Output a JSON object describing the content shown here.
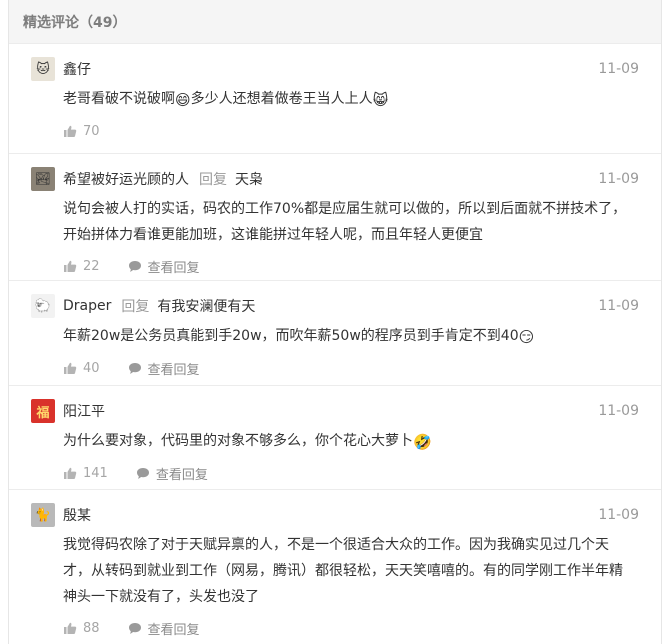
{
  "header": {
    "title": "精选评论（49）"
  },
  "comments": [
    {
      "user": "鑫仔",
      "reply_word": "",
      "reply_to": "",
      "date": "11-09",
      "text_a": "老哥看破不说破啊",
      "emoji_a": "😄",
      "text_b": "多少人还想着做卷王当人上人",
      "emoji_b": "😸",
      "likes": "70",
      "view_replies": "",
      "avatar_glyph": "🐱",
      "avatar_bg": "#e8e3d8"
    },
    {
      "user": "希望被好运光顾的人",
      "reply_word": "回复",
      "reply_to": "天枭",
      "date": "11-09",
      "text_a": "说句会被人打的实话，码农的工作70%都是应届生就可以做的，所以到后面就不拼技术了，开始拼体力看谁更能加班，这谁能拼过年轻人呢，而且年轻人更便宜",
      "emoji_a": "",
      "text_b": "",
      "emoji_b": "",
      "likes": "22",
      "view_replies": "查看回复",
      "avatar_glyph": "🏞",
      "avatar_bg": "#8a8275"
    },
    {
      "user": "Draper",
      "reply_word": "回复",
      "reply_to": "有我安澜便有天",
      "date": "11-09",
      "text_a": "年薪20w是公务员真能到手20w，而吹年薪50w的程序员到手肯定不到40",
      "emoji_a": "😏",
      "text_b": "",
      "emoji_b": "",
      "likes": "40",
      "view_replies": "查看回复",
      "avatar_glyph": "🐑",
      "avatar_bg": "#f2f2f2"
    },
    {
      "user": "阳江平",
      "reply_word": "",
      "reply_to": "",
      "date": "11-09",
      "text_a": "为什么要对象，代码里的对象不够多么，你个花心大萝卜",
      "emoji_a": "🤣",
      "text_b": "",
      "emoji_b": "",
      "likes": "141",
      "view_replies": "查看回复",
      "avatar_glyph": "福",
      "avatar_bg": "#d9322b"
    },
    {
      "user": "殷某",
      "reply_word": "",
      "reply_to": "",
      "date": "11-09",
      "text_a": "我觉得码农除了对于天赋异禀的人，不是一个很适合大众的工作。因为我确实见过几个天才，从转码到就业到工作（网易，腾讯）都很轻松，天天笑嘻嘻的。有的同学刚工作半年精神头一下就没有了，头发也没了",
      "emoji_a": "",
      "text_b": "",
      "emoji_b": "",
      "likes": "88",
      "view_replies": "查看回复",
      "avatar_glyph": "🐈",
      "avatar_bg": "#b9b9b9"
    }
  ]
}
